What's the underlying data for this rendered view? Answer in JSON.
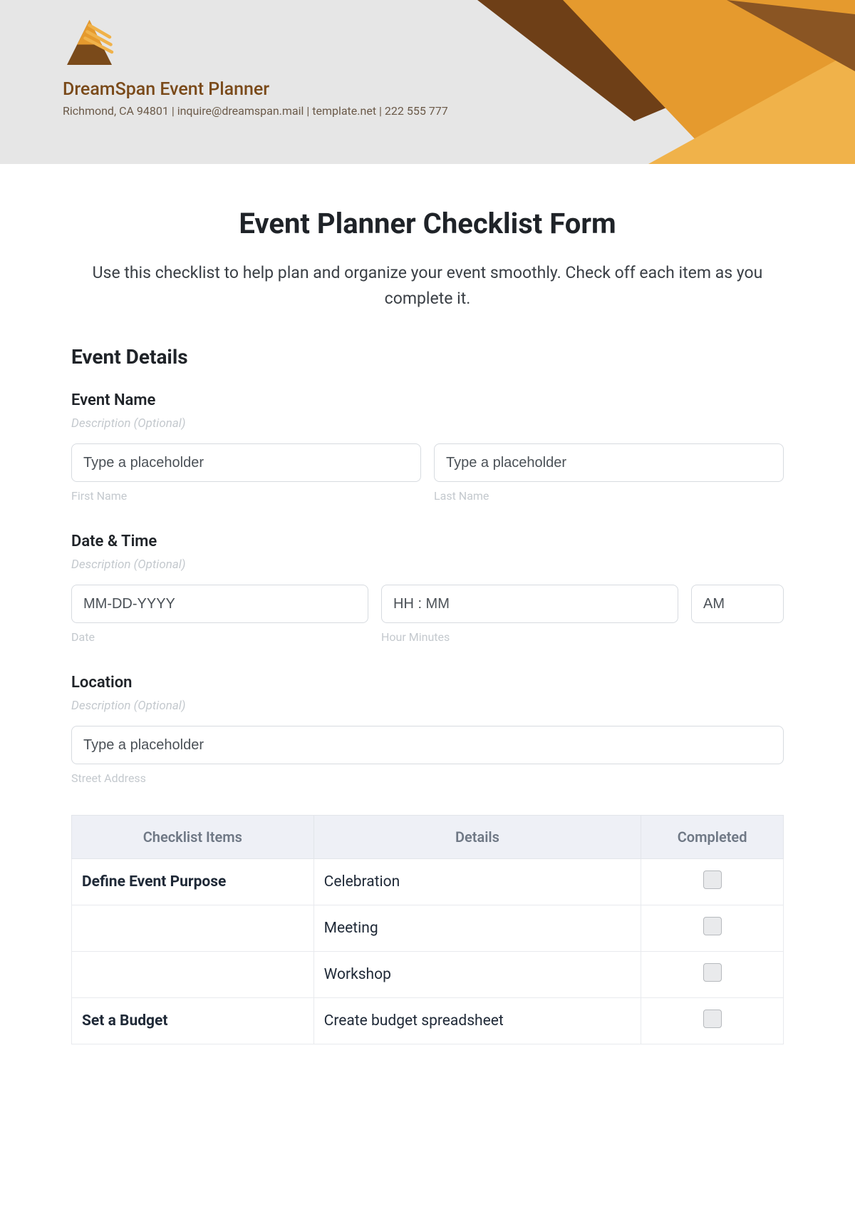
{
  "header": {
    "company_name": "DreamSpan Event Planner",
    "company_info": "Richmond, CA 94801 | inquire@dreamspan.mail | template.net | 222 555 777"
  },
  "form": {
    "title": "Event Planner Checklist Form",
    "intro": "Use this checklist to help plan and organize your event smoothly. Check off each item as you complete it.",
    "section_details": "Event Details",
    "event_name": {
      "label": "Event Name",
      "desc": "Description (Optional)",
      "first_placeholder": "Type a placeholder",
      "first_sub": "First Name",
      "last_placeholder": "Type a placeholder",
      "last_sub": "Last Name"
    },
    "date_time": {
      "label": "Date & Time",
      "desc": "Description (Optional)",
      "date_placeholder": "MM-DD-YYYY",
      "date_sub": "Date",
      "time_placeholder": "HH : MM",
      "time_sub": "Hour Minutes",
      "ampm_placeholder": "AM"
    },
    "location": {
      "label": "Location",
      "desc": "Description (Optional)",
      "street_placeholder": "Type a placeholder",
      "street_sub": "Street Address"
    }
  },
  "checklist": {
    "headers": {
      "items": "Checklist Items",
      "details": "Details",
      "completed": "Completed"
    },
    "rows": [
      {
        "item": "Define Event Purpose",
        "detail": "Celebration"
      },
      {
        "item": "",
        "detail": "Meeting"
      },
      {
        "item": "",
        "detail": "Workshop"
      },
      {
        "item": "Set a Budget",
        "detail": "Create budget spreadsheet"
      }
    ]
  }
}
